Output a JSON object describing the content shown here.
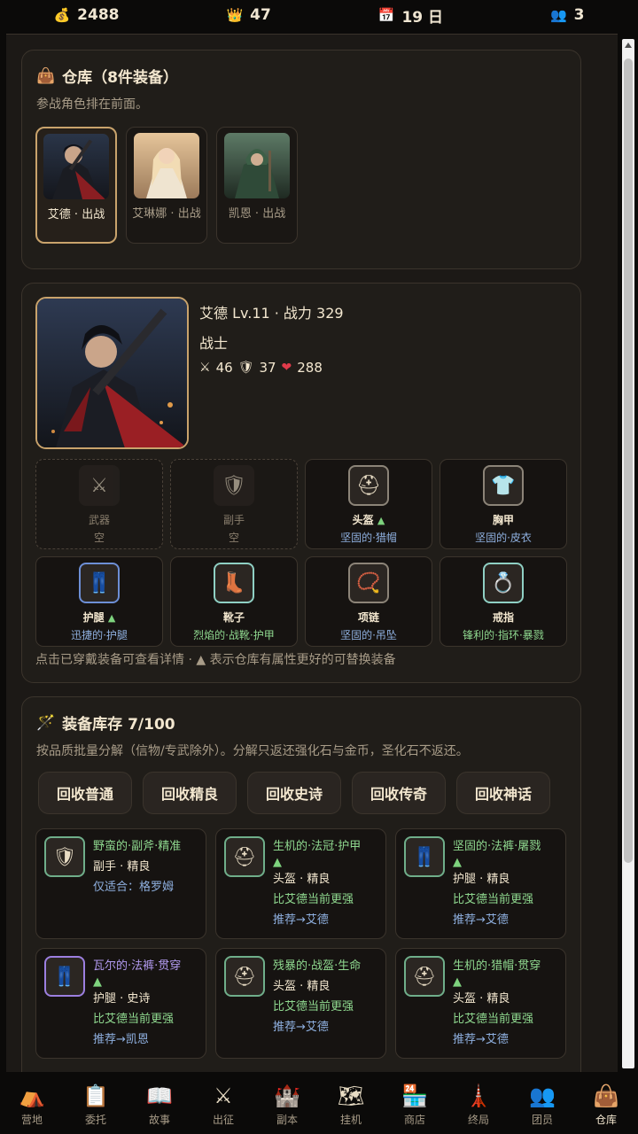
{
  "top": {
    "gold": "2488",
    "crown": "47",
    "day": "19 日",
    "members": "3",
    "icons": [
      "coin-icon",
      "crown-icon",
      "calendar-icon",
      "people-icon"
    ]
  },
  "warehouse": {
    "title": "仓库（8件装备）",
    "subtitle": "参战角色排在前面。",
    "heroes": [
      {
        "name": "艾德 · 出战"
      },
      {
        "name": "艾琳娜 · 出战"
      },
      {
        "name": "凯恩 · 出战"
      }
    ]
  },
  "character": {
    "line1": "艾德 Lv.11 · 战力 329",
    "class": "战士",
    "attack": "46",
    "defense": "37",
    "hp": "288",
    "slots": [
      {
        "label": "武器",
        "value": "空",
        "icon": "sword-icon"
      },
      {
        "label": "副手",
        "value": "空",
        "icon": "shield-icon"
      },
      {
        "label": "头盔",
        "arrow": "▲",
        "value": "坚固的·猎帽",
        "icon": "helmet-icon"
      },
      {
        "label": "胸甲",
        "value": "坚固的·皮衣",
        "icon": "shirt-icon"
      },
      {
        "label": "护腿",
        "arrow": "▲",
        "value": "迅捷的·护腿",
        "icon": "pants-icon"
      },
      {
        "label": "靴子",
        "value": "烈焰的·战靴·护甲",
        "icon": "boot-icon"
      },
      {
        "label": "项链",
        "value": "坚固的·吊坠",
        "icon": "necklace-icon"
      },
      {
        "label": "戒指",
        "value": "锋利的·指环·暴戮",
        "icon": "ring-icon"
      }
    ],
    "note": "点击已穿戴装备可查看详情 · ▲ 表示仓库有属性更好的可替换装备"
  },
  "inventory": {
    "title": "装备库存 7/100",
    "subtitle": "按品质批量分解（信物/专武除外）。分解只返还强化石与金币，圣化石不返还。",
    "buttons": [
      "回收普通",
      "回收精良",
      "回收史诗",
      "回收传奇",
      "回收神话"
    ],
    "items": [
      {
        "name": "野蛮的·副斧·精准",
        "line2": "副手 · 精良",
        "line3": "仅适合：格罗姆",
        "icon": "shield-icon",
        "quality": "green"
      },
      {
        "name": "生机的·法冠·护甲",
        "arrow": "▲",
        "line2": "头盔 · 精良",
        "line3": "比艾德当前更强",
        "line4": "推荐→艾德",
        "icon": "helmet-icon",
        "quality": "green"
      },
      {
        "name": "坚固的·法裤·屠戮",
        "arrow": "▲",
        "line2": "护腿 · 精良",
        "line3": "比艾德当前更强",
        "line4": "推荐→艾德",
        "icon": "pants-icon",
        "quality": "green"
      },
      {
        "name": "瓦尔的·法裤·贯穿",
        "arrow": "▲",
        "line2": "护腿 · 史诗",
        "line3": "比艾德当前更强",
        "line4": "推荐→凯恩",
        "icon": "pants-icon",
        "quality": "purple"
      },
      {
        "name": "残暴的·战盔·生命",
        "line2": "头盔 · 精良",
        "line3": "比艾德当前更强",
        "line4": "推荐→艾德",
        "icon": "helmet-icon",
        "quality": "green"
      },
      {
        "name": "生机的·猎帽·贯穿",
        "arrow": "▲",
        "line2": "头盔 · 精良",
        "line3": "比艾德当前更强",
        "line4": "推荐→艾德",
        "icon": "helmet-icon",
        "quality": "green"
      }
    ]
  },
  "nav": [
    {
      "label": "营地",
      "icon": "camp-icon"
    },
    {
      "label": "委托",
      "icon": "clipboard-icon"
    },
    {
      "label": "故事",
      "icon": "book-icon"
    },
    {
      "label": "出征",
      "icon": "swords-icon"
    },
    {
      "label": "副本",
      "icon": "castle-icon"
    },
    {
      "label": "挂机",
      "icon": "map-icon"
    },
    {
      "label": "商店",
      "icon": "shop-icon"
    },
    {
      "label": "终局",
      "icon": "tower-icon"
    },
    {
      "label": "团员",
      "icon": "people-icon"
    },
    {
      "label": "仓库",
      "icon": "bag-icon"
    }
  ]
}
